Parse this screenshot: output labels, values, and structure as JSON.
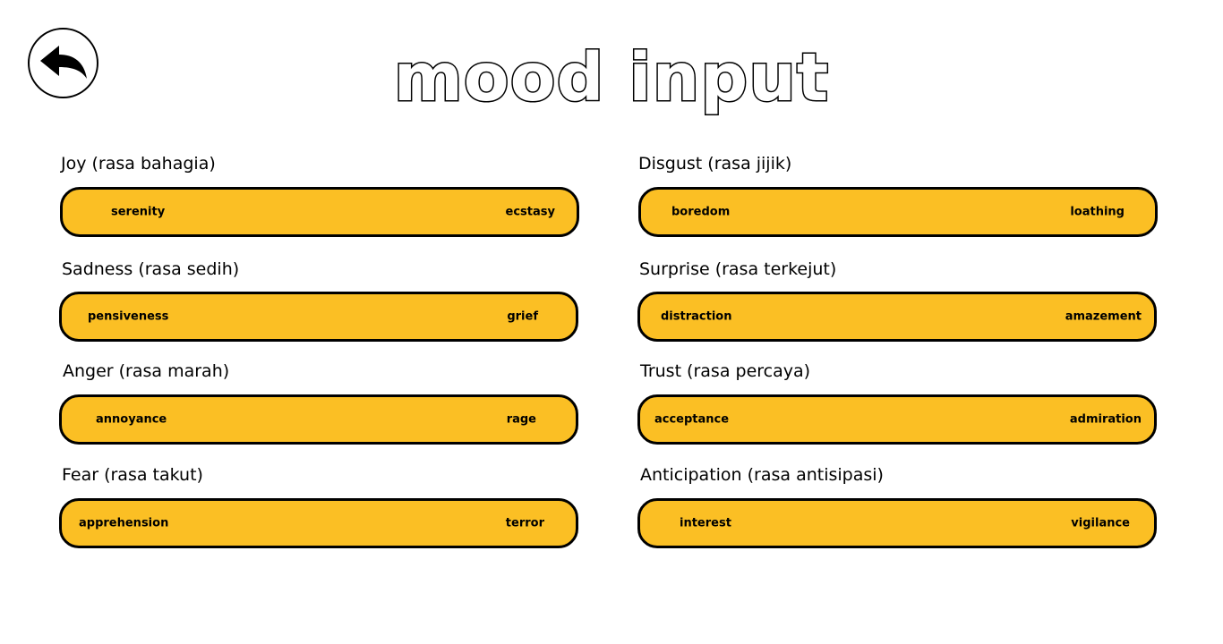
{
  "header": {
    "title": "mood input",
    "back_icon": "back-arrow-icon"
  },
  "moods": [
    {
      "label": "Joy (rasa bahagia)",
      "low": "serenity",
      "high": "ecstasy"
    },
    {
      "label": "Sadness (rasa sedih)",
      "low": "pensiveness",
      "high": "grief"
    },
    {
      "label": "Anger (rasa marah)",
      "low": "annoyance",
      "high": "rage"
    },
    {
      "label": "Fear (rasa takut)",
      "low": "apprehension",
      "high": "terror"
    },
    {
      "label": "Disgust (rasa jijik)",
      "low": "boredom",
      "high": "loathing"
    },
    {
      "label": "Surprise (rasa terkejut)",
      "low": "distraction",
      "high": "amazement"
    },
    {
      "label": "Trust (rasa percaya)",
      "low": "acceptance",
      "high": "admiration"
    },
    {
      "label": "Anticipation (rasa antisipasi)",
      "low": "interest",
      "high": "vigilance"
    }
  ],
  "colors": {
    "slider_fill": "#fbbf24",
    "outline": "#000000",
    "background": "#ffffff"
  }
}
